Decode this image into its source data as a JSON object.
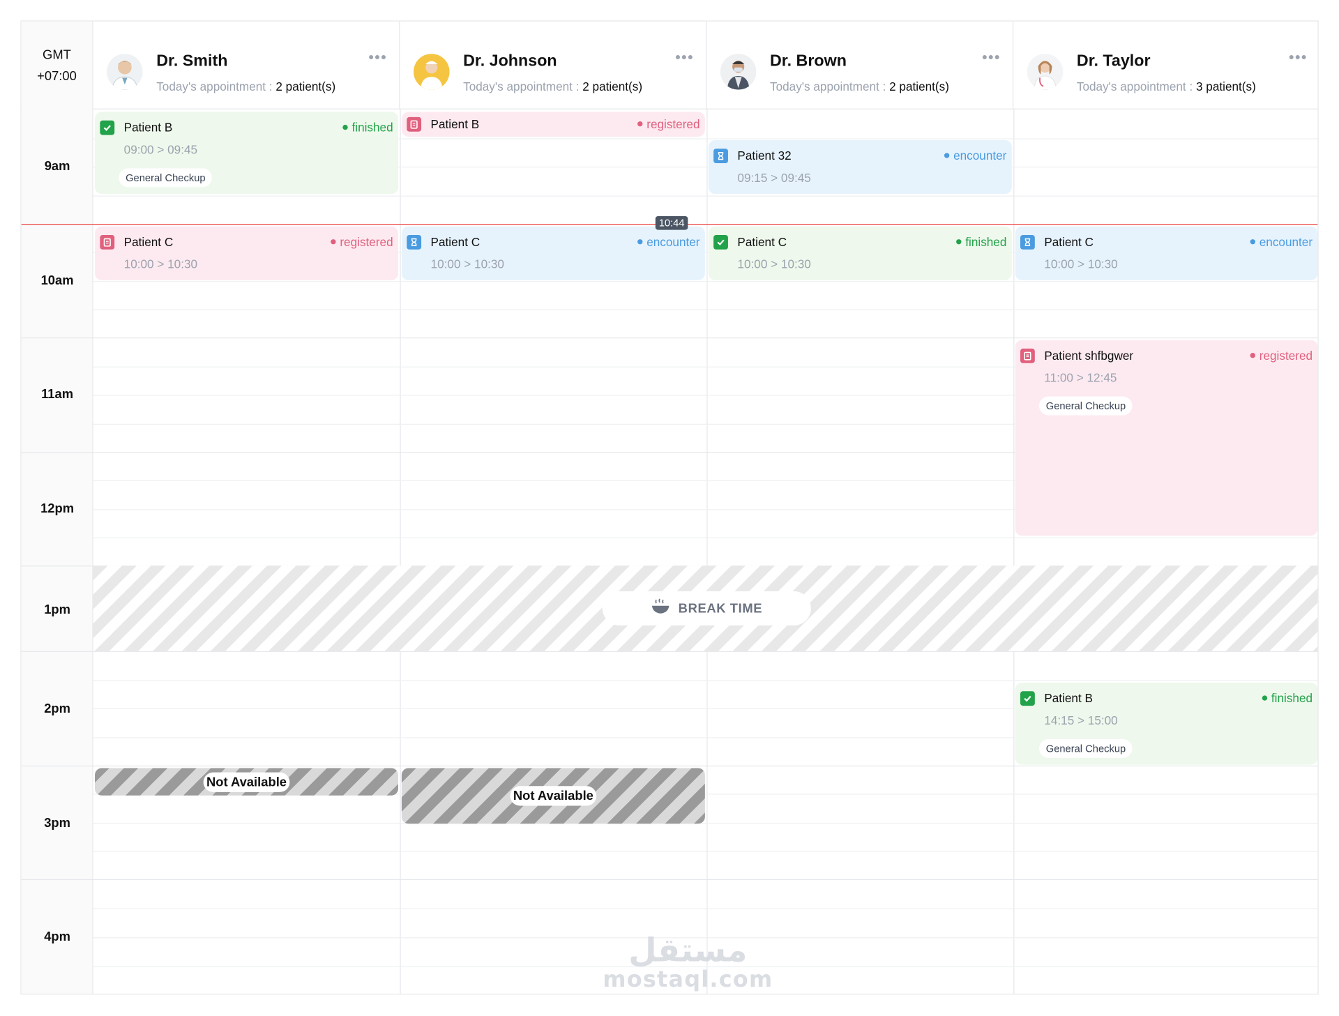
{
  "timezone": {
    "line1": "GMT",
    "line2": "+07:00"
  },
  "doctors": [
    {
      "name": "Dr. Smith",
      "appointment_label": "Today's appointment :",
      "count": "2 patient(s)",
      "menu": "•••"
    },
    {
      "name": "Dr. Johnson",
      "appointment_label": "Today's appointment :",
      "count": "2 patient(s)",
      "menu": "•••"
    },
    {
      "name": "Dr. Brown",
      "appointment_label": "Today's appointment :",
      "count": "2 patient(s)",
      "menu": "•••"
    },
    {
      "name": "Dr. Taylor",
      "appointment_label": "Today's appointment :",
      "count": "3 patient(s)",
      "menu": "•••"
    }
  ],
  "hours": [
    "9am",
    "10am",
    "11am",
    "12pm",
    "1pm",
    "2pm",
    "3pm",
    "4pm"
  ],
  "now_indicator": "10:44",
  "appointments": [
    {
      "doctor": 0,
      "patient": "Patient B",
      "status": "finished",
      "time": "09:00 > 09:45",
      "tag": "General Checkup"
    },
    {
      "doctor": 1,
      "patient": "Patient B",
      "status": "registered",
      "time": "",
      "tag": ""
    },
    {
      "doctor": 2,
      "patient": "Patient 32",
      "status": "encounter",
      "time": "09:15 > 09:45",
      "tag": ""
    },
    {
      "doctor": 0,
      "patient": "Patient C",
      "status": "registered",
      "time": "10:00 > 10:30",
      "tag": ""
    },
    {
      "doctor": 1,
      "patient": "Patient C",
      "status": "encounter",
      "time": "10:00 > 10:30",
      "tag": ""
    },
    {
      "doctor": 2,
      "patient": "Patient C",
      "status": "finished",
      "time": "10:00 > 10:30",
      "tag": ""
    },
    {
      "doctor": 3,
      "patient": "Patient C",
      "status": "encounter",
      "time": "10:00 > 10:30",
      "tag": ""
    },
    {
      "doctor": 3,
      "patient": "Patient shfbgwer",
      "status": "registered",
      "time": "11:00 > 12:45",
      "tag": "General Checkup"
    },
    {
      "doctor": 3,
      "patient": "Patient B",
      "status": "finished",
      "time": "14:15 > 15:00",
      "tag": "General Checkup"
    }
  ],
  "break": {
    "label": "BREAK TIME"
  },
  "unavailable": [
    {
      "doctor": 0,
      "label": "Not Available"
    },
    {
      "doctor": 1,
      "label": "Not Available"
    }
  ],
  "watermark": {
    "arabic": "مستقل",
    "latin": "mostaql.com"
  },
  "colors": {
    "finished": "#22a24a",
    "registered": "#e0607e",
    "encounter": "#4a9be0",
    "now_line": "#ef4444"
  }
}
